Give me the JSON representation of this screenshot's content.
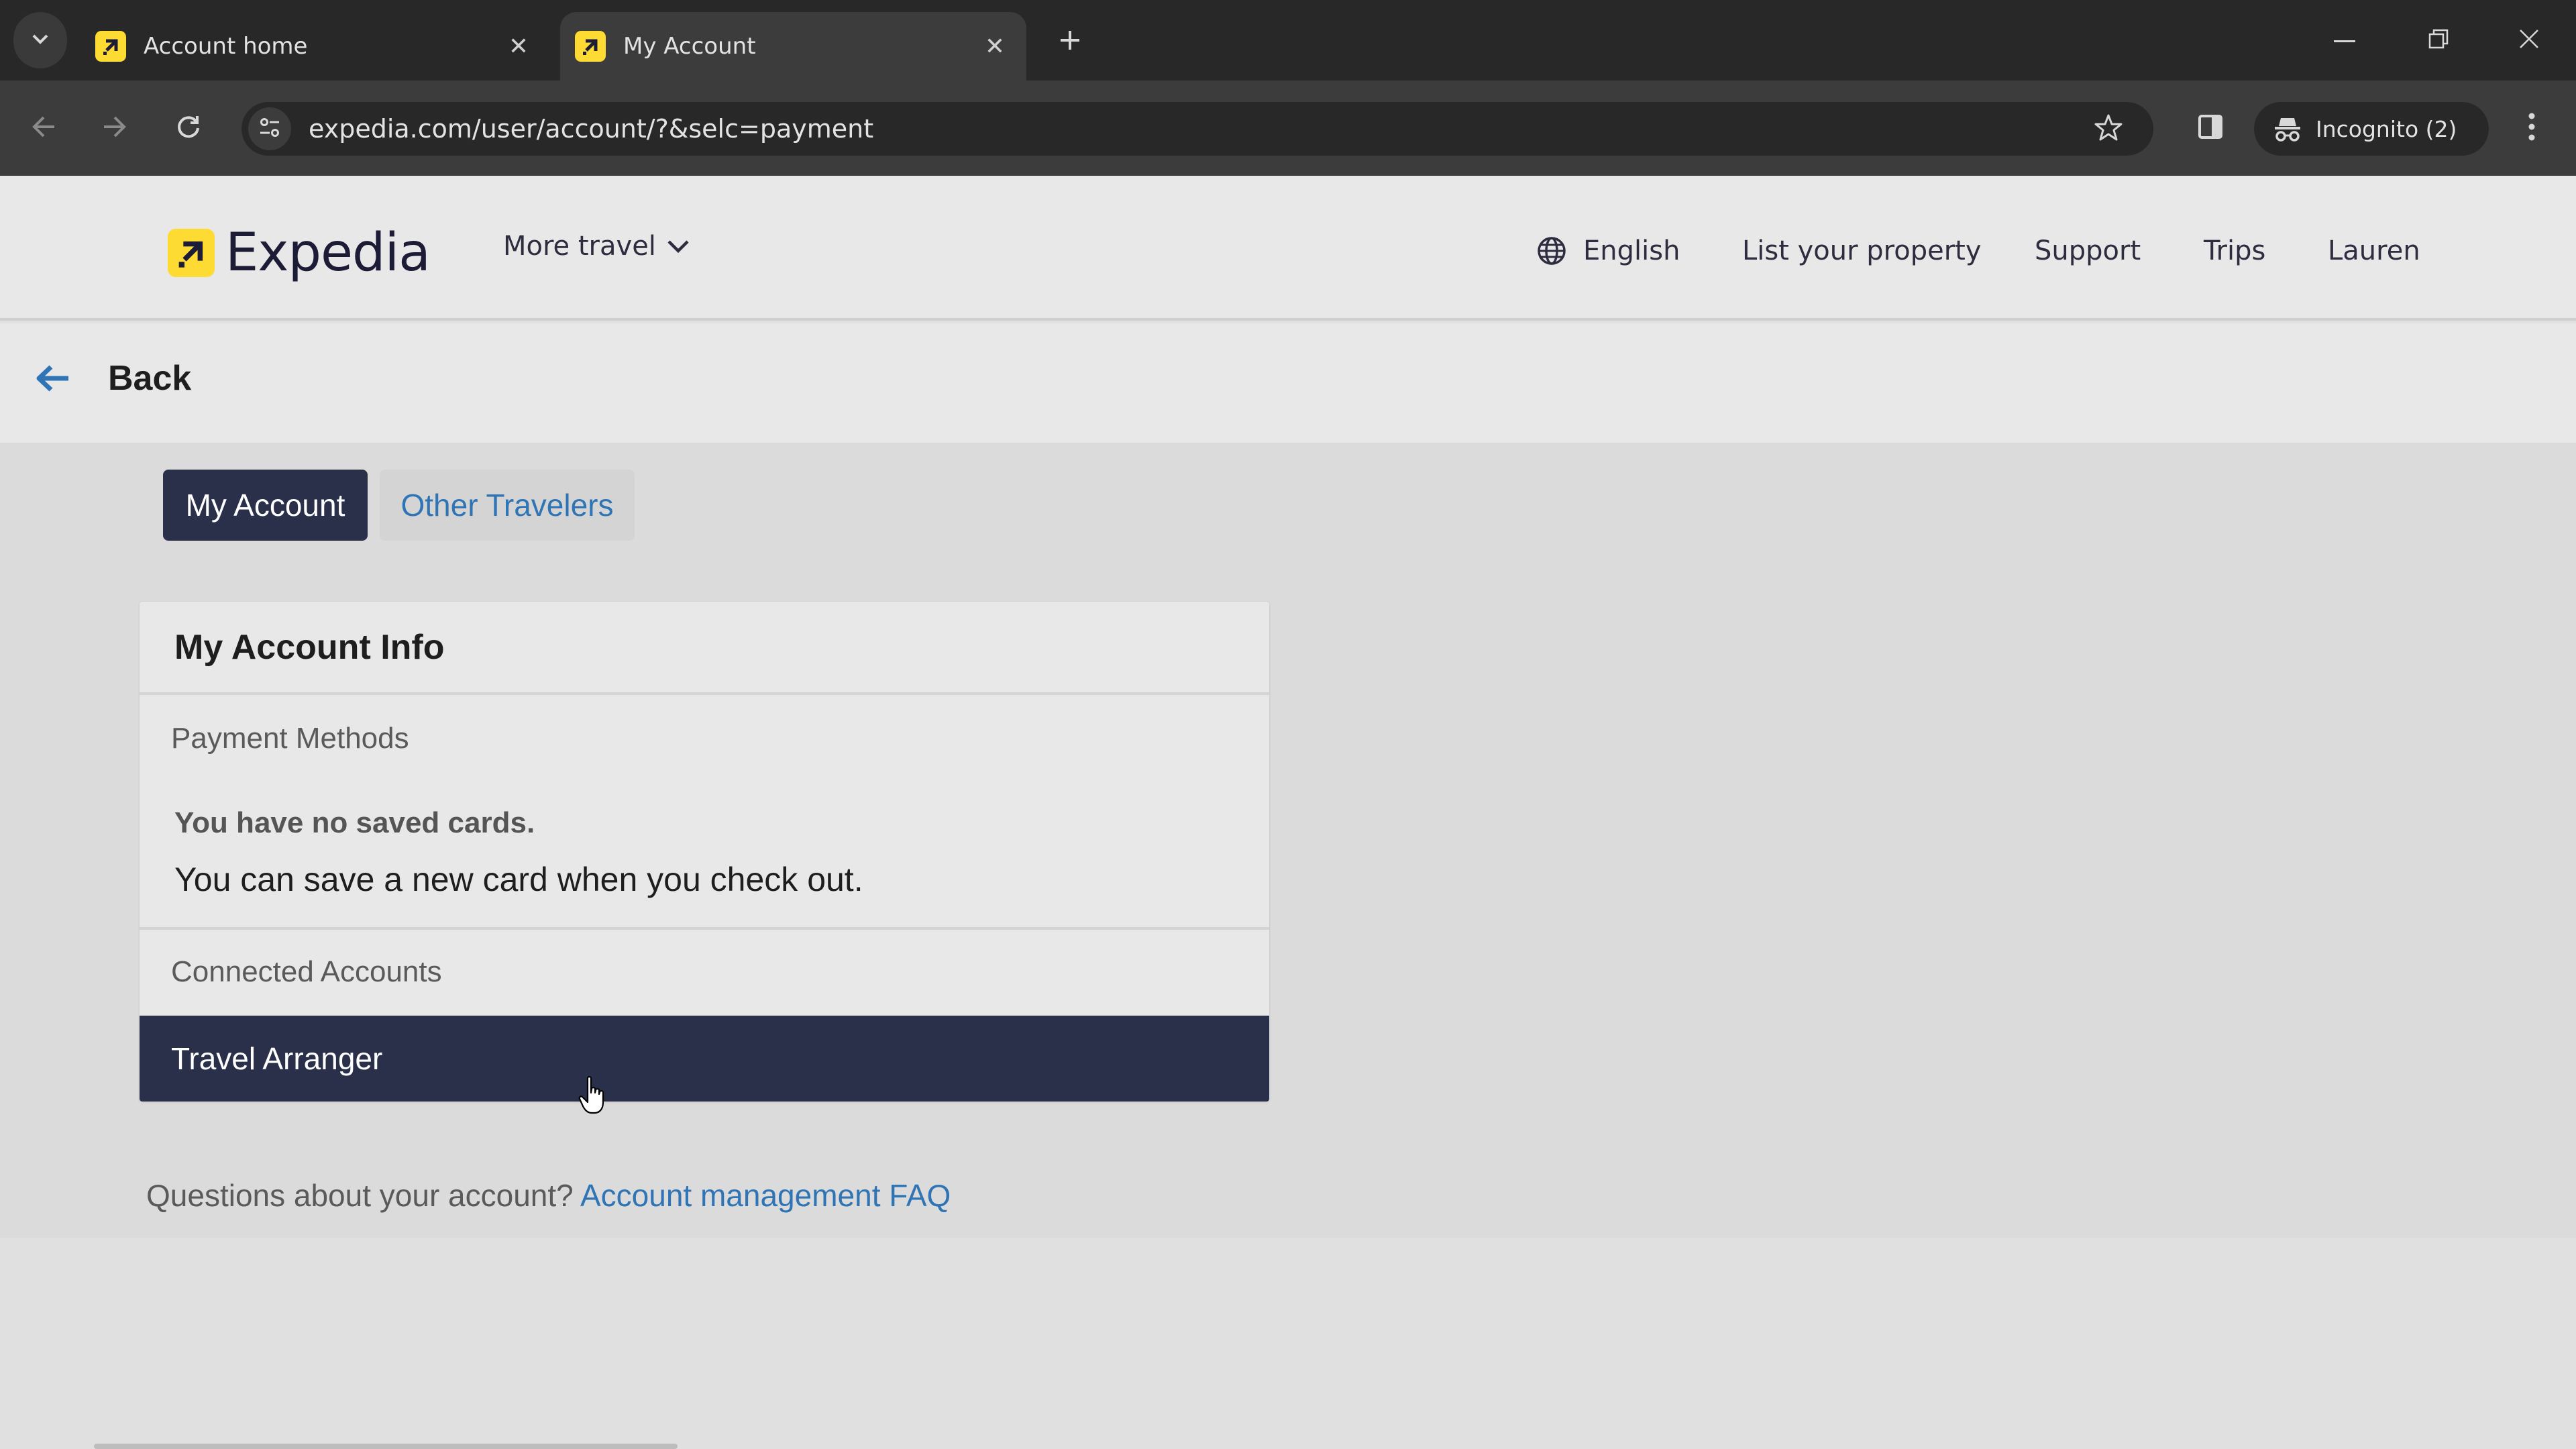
{
  "browser": {
    "tabs": [
      {
        "title": "Account home",
        "active": false,
        "favicon": "expedia-favicon",
        "close_icon": "close-icon"
      },
      {
        "title": "My Account",
        "active": true,
        "favicon": "expedia-favicon",
        "close_icon": "close-icon"
      }
    ],
    "new_tab_icon": "plus-icon",
    "tab_list_icon": "chevron-down-icon",
    "url": "expedia.com/user/account/?&selc=payment",
    "incognito_label": "Incognito (2)",
    "window_controls": [
      "minimize-icon",
      "restore-icon",
      "close-icon"
    ]
  },
  "header": {
    "brand": "Expedia",
    "more_travel": "More travel",
    "nav": {
      "language": "English",
      "list_property": "List your property",
      "support": "Support",
      "trips": "Trips",
      "user": "Lauren"
    }
  },
  "back_bar": {
    "back_label": "Back"
  },
  "segments": {
    "my_account": "My Account",
    "other_travelers": "Other Travelers",
    "active": "My Account"
  },
  "card": {
    "title": "My Account Info",
    "payment_methods": {
      "label": "Payment Methods",
      "empty_title": "You have no saved cards.",
      "empty_note": "You can save a new card when you check out."
    },
    "connected_accounts": {
      "label": "Connected Accounts"
    },
    "travel_arranger": "Travel Arranger"
  },
  "faq": {
    "question": "Questions about your account?",
    "link": "Account management FAQ"
  },
  "colors": {
    "brand_yellow": "#fddb32",
    "navy": "#2a304a",
    "link_blue": "#2f74b5"
  }
}
